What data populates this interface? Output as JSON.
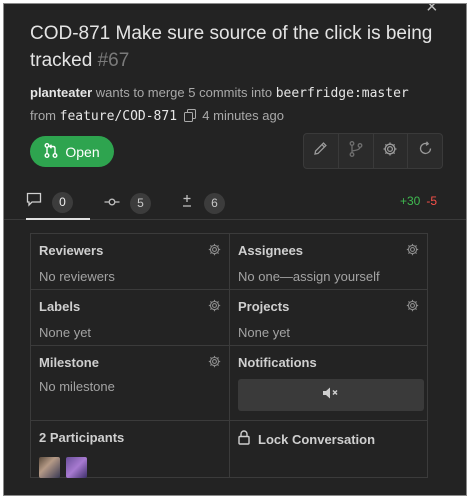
{
  "pr": {
    "title": "COD-871 Make sure source of the click is being tracked",
    "number": "#67",
    "author": "planteater",
    "action_text": "wants to merge 5 commits into",
    "base_branch": "beerfridge:master",
    "from_text": "from",
    "head_branch": "feature/COD-871",
    "time_ago": "4 minutes ago",
    "status": "Open"
  },
  "tabs": [
    {
      "icon": "comment-icon",
      "count": "0"
    },
    {
      "icon": "commit-icon",
      "count": "5"
    },
    {
      "icon": "plus-minus-icon",
      "count": "6"
    }
  ],
  "diffstat": {
    "additions": "+30",
    "deletions": "-5"
  },
  "sidebar": {
    "reviewers": {
      "label": "Reviewers",
      "value": "No reviewers"
    },
    "assignees": {
      "label": "Assignees",
      "value": "No one—assign yourself"
    },
    "labels": {
      "label": "Labels",
      "value": "None yet"
    },
    "projects": {
      "label": "Projects",
      "value": "None yet"
    },
    "milestone": {
      "label": "Milestone",
      "value": "No milestone"
    },
    "notifications": {
      "label": "Notifications"
    },
    "participants": {
      "label": "2 Participants"
    },
    "lock": {
      "label": "Lock Conversation"
    }
  },
  "colors": {
    "open_green": "#2ea44f",
    "additions": "#3fb950",
    "deletions": "#f85149",
    "background": "#232323"
  }
}
